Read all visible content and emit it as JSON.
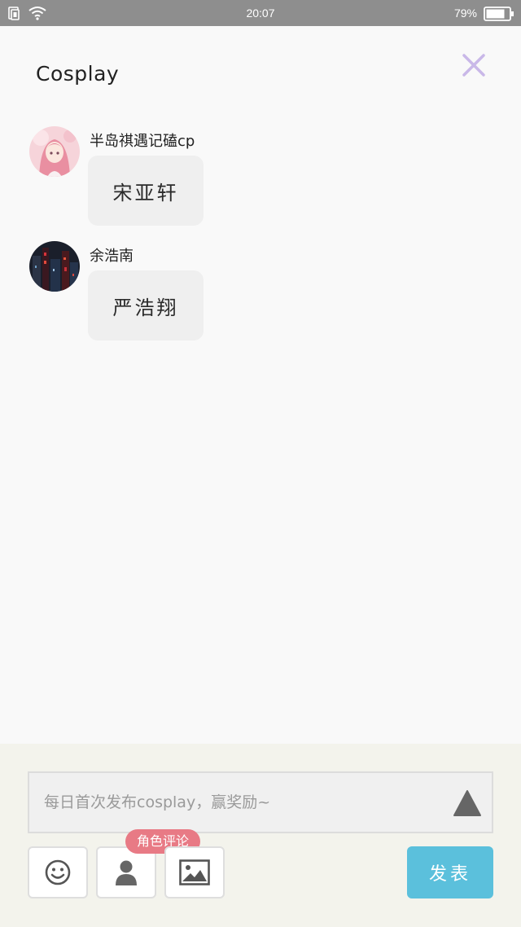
{
  "status_bar": {
    "time": "20:07",
    "battery": "79%",
    "icons": [
      "sim-icon",
      "wifi-icon",
      "battery-icon"
    ]
  },
  "header": {
    "title": "Cosplay",
    "close_icon": "close-icon",
    "close_color": "#c9b8e8"
  },
  "messages": [
    {
      "username": "半岛祺遇记磕cp",
      "text": "宋亚轩",
      "avatar": "avatar-pink-girl"
    },
    {
      "username": "余浩南",
      "text": "严浩翔",
      "avatar": "avatar-dark-city"
    }
  ],
  "composer": {
    "placeholder": "每日首次发布cosplay，赢奖励~",
    "send_icon": "triangle-send-icon",
    "tools": [
      "emoji-icon",
      "person-icon",
      "image-icon"
    ],
    "role_badge": "角色评论",
    "publish_label": "发表",
    "colors": {
      "publish": "#5bc0dc",
      "badge": "#e87a85"
    }
  }
}
